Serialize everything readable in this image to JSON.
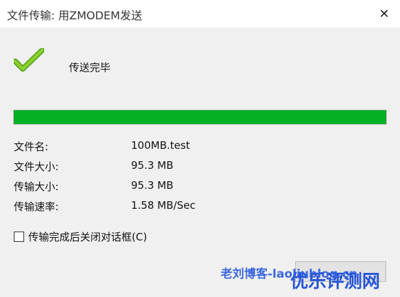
{
  "window": {
    "title": "文件传输: 用ZMODEM发送"
  },
  "status": {
    "icon": "success-check-icon",
    "text": "传送完毕"
  },
  "progress": {
    "percent": 100,
    "color": "#06b025"
  },
  "info": [
    {
      "label": "文件名:",
      "value": "100MB.test"
    },
    {
      "label": "文件大小:",
      "value": "95.3 MB"
    },
    {
      "label": "传输大小:",
      "value": "95.3 MB"
    },
    {
      "label": "传输速率:",
      "value": "1.58 MB/Sec"
    }
  ],
  "options": {
    "close_after_transfer_label": "传输完成后关闭对话框(C)",
    "checked": false
  },
  "watermarks": {
    "left": "老刘博客-laoliublog.cn",
    "right": "优乐评测网"
  }
}
